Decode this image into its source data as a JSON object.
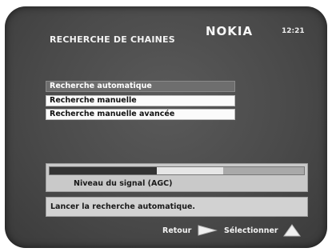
{
  "header": {
    "title": "RECHERCHE DE CHAINES",
    "brand": "NOKIA",
    "time": "12:21"
  },
  "menu": {
    "items": [
      {
        "label": "Recherche automatique",
        "selected": true
      },
      {
        "label": "Recherche manuelle",
        "selected": false
      },
      {
        "label": "Recherche manuelle avancée",
        "selected": false
      }
    ]
  },
  "signal": {
    "label": "Niveau du signal (AGC)",
    "level_fraction": 0.42
  },
  "info": {
    "message": "Lancer la recherche automatique."
  },
  "footer": {
    "back_label": "Retour",
    "select_label": "Sélectionner",
    "back_icon": "right-arrow-button-icon",
    "select_icon": "up-triangle-button-icon"
  }
}
